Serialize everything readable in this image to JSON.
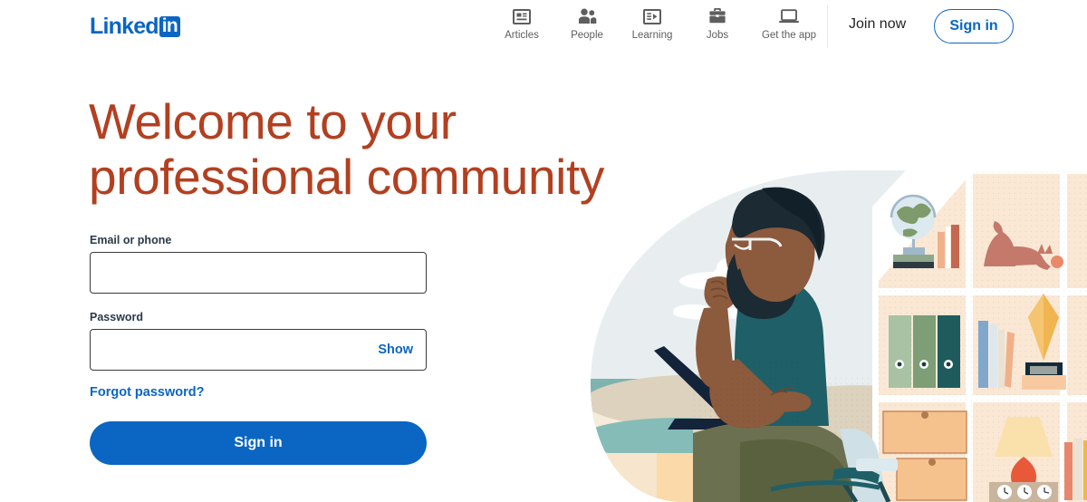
{
  "header": {
    "logo": {
      "word": "Linked",
      "badge": "in",
      "name": "linkedin-logo"
    },
    "nav_items": [
      {
        "label": "Articles",
        "icon": "articles-icon"
      },
      {
        "label": "People",
        "icon": "people-icon"
      },
      {
        "label": "Learning",
        "icon": "learning-icon"
      },
      {
        "label": "Jobs",
        "icon": "jobs-icon"
      },
      {
        "label": "Get the app",
        "icon": "get-the-app-icon"
      }
    ],
    "join_now": "Join now",
    "sign_in": "Sign in"
  },
  "hero": {
    "headline": "Welcome to your\nprofessional community"
  },
  "form": {
    "email_label": "Email or phone",
    "email_value": "",
    "email_placeholder": "",
    "password_label": "Password",
    "password_value": "",
    "password_placeholder": "",
    "show_label": "Show",
    "forgot_password": "Forgot password?",
    "submit_label": "Sign in"
  },
  "illustration": {
    "name": "person-working-on-laptop-illustration",
    "alt": "Man with glasses and beard sitting at a laptop in front of a bookshelf with a globe, cat, binders, lamp and books, beach scene in background"
  },
  "colors": {
    "brand_blue": "#0a66c2",
    "headline_orange": "#b24020",
    "label_dark": "#2b3a4a",
    "nav_label_gray": "#5e5e5e",
    "border_gray": "#3b3b3b",
    "sky": "#e8eef0",
    "shelf": "#fae8d5",
    "skin": "#8c5a3c",
    "shirt": "#1f6068",
    "pants": "#6b7150",
    "hair": "#1b2a33"
  }
}
